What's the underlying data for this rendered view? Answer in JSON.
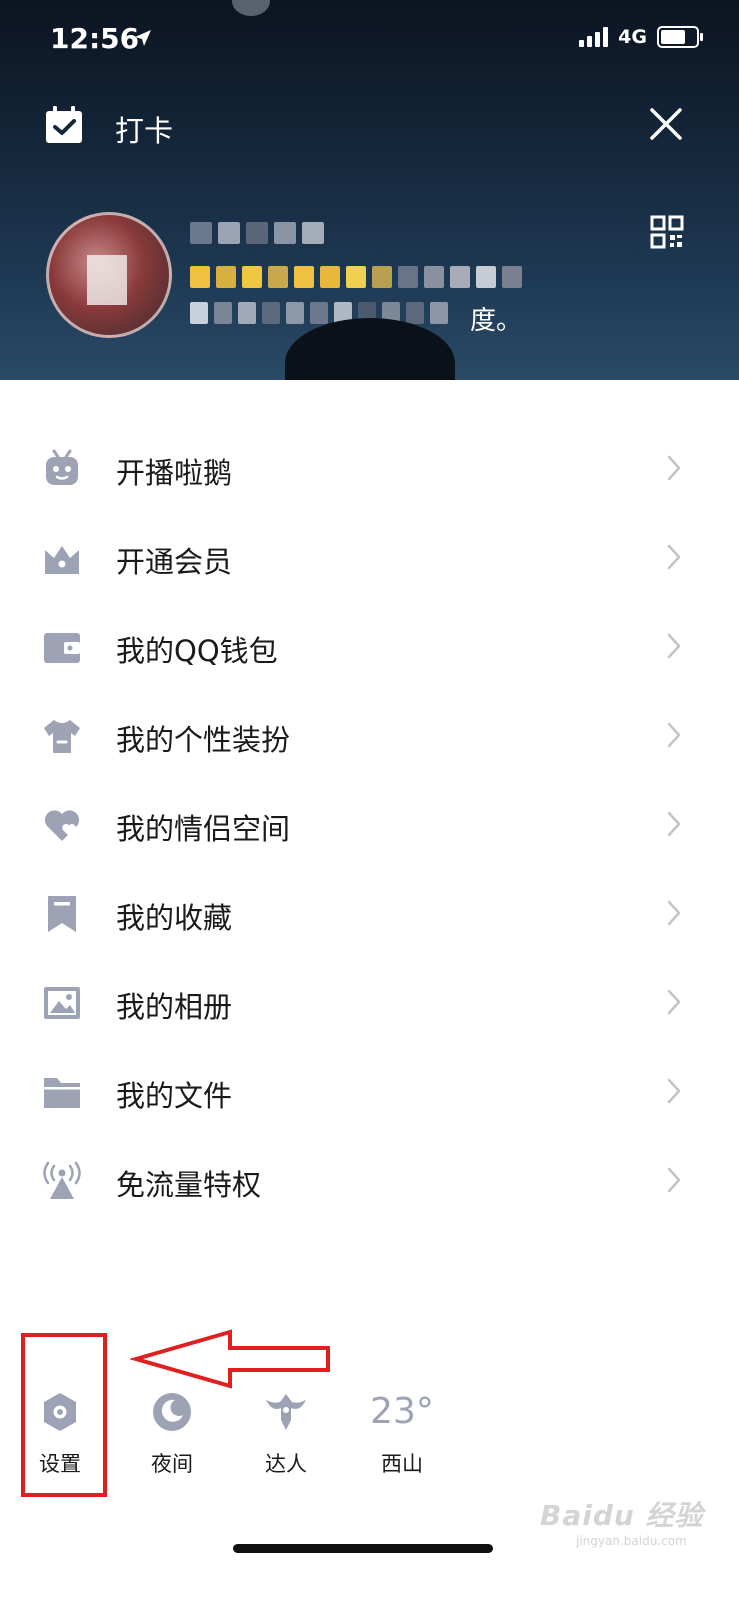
{
  "status_bar": {
    "time": "12:56",
    "network": "4G"
  },
  "header": {
    "checkin_label": "打卡",
    "signature_tail": "度。"
  },
  "menu": {
    "items": [
      {
        "label": "开播啦鹅",
        "icon": "tv-mascot-icon"
      },
      {
        "label": "开通会员",
        "icon": "crown-icon"
      },
      {
        "label": "我的QQ钱包",
        "icon": "wallet-icon"
      },
      {
        "label": "我的个性装扮",
        "icon": "tshirt-icon"
      },
      {
        "label": "我的情侣空间",
        "icon": "couple-heart-icon"
      },
      {
        "label": "我的收藏",
        "icon": "bookmark-icon"
      },
      {
        "label": "我的相册",
        "icon": "photo-album-icon"
      },
      {
        "label": "我的文件",
        "icon": "folder-icon"
      },
      {
        "label": "免流量特权",
        "icon": "broadcast-tower-icon"
      }
    ]
  },
  "dock": {
    "settings": "设置",
    "night": "夜间",
    "expert": "达人",
    "weather_temp": "23°",
    "weather_location": "西山"
  },
  "watermark": {
    "brand": "Baidu 经验",
    "url": "jingyan.baidu.com"
  },
  "colors": {
    "icon_gray": "#9ea2b5",
    "annotation_red": "#e02020",
    "chevron": "#c4c4c8"
  }
}
